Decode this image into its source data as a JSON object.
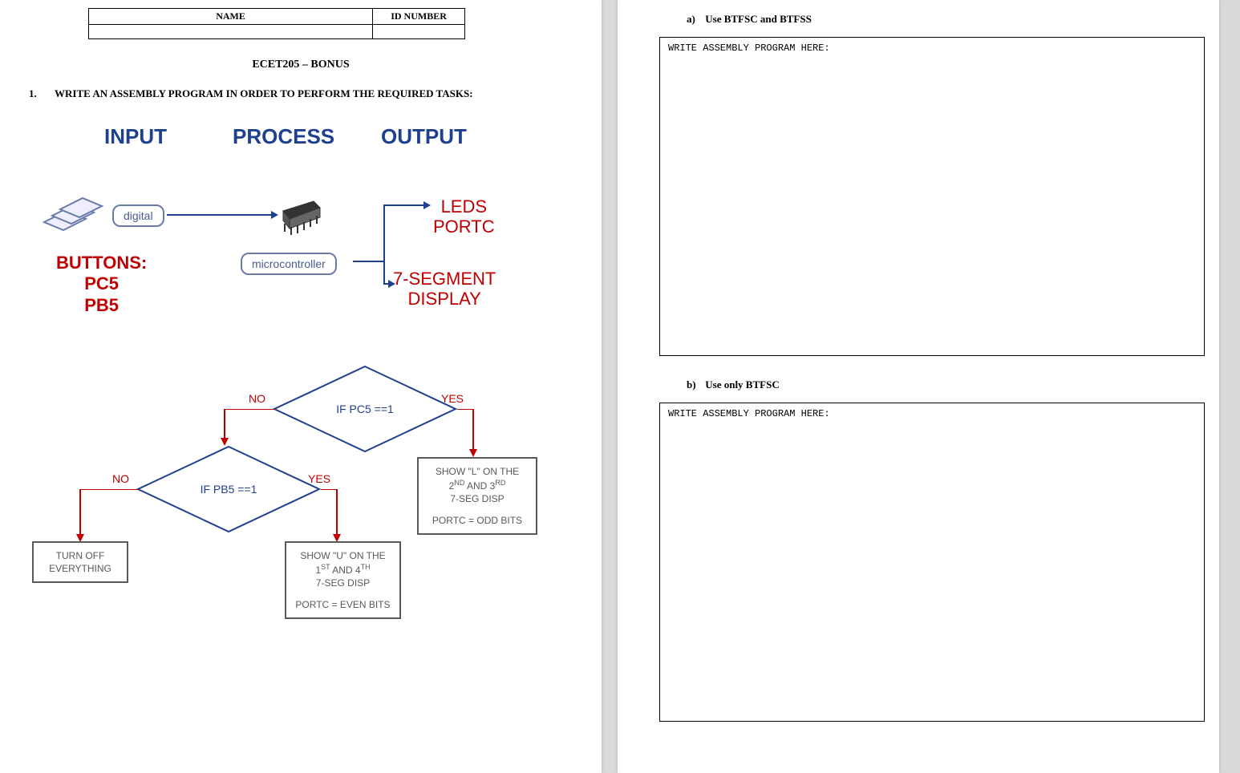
{
  "header": {
    "name_col": "NAME",
    "id_col": "ID NUMBER",
    "name_val": "",
    "id_val": ""
  },
  "course_title": "ECET205 – BONUS",
  "q1": {
    "num": "1.",
    "text": "WRITE AN ASSEMBLY PROGRAM IN ORDER TO PERFORM THE REQUIRED TASKS:"
  },
  "ipo": {
    "hdr_input": "INPUT",
    "hdr_process": "PROCESS",
    "hdr_output": "OUTPUT",
    "digital": "digital",
    "microcontroller": "microcontroller",
    "buttons_title": "BUTTONS:",
    "buttons_l1": "PC5",
    "buttons_l2": "PB5",
    "out_leds_l1": "LEDS",
    "out_leds_l2": "PORTC",
    "out_seg_l1": "7-SEGMENT",
    "out_seg_l2": "DISPLAY"
  },
  "flow": {
    "d1": "IF PC5 ==1",
    "d2": "IF PB5 ==1",
    "yes": "YES",
    "no": "NO",
    "box_L_l1": "SHOW \"L\" ON THE",
    "box_L_l2a": "2",
    "box_L_l2sup1": "ND",
    "box_L_l2mid": " AND 3",
    "box_L_l2sup2": "RD",
    "box_L_l3": "7-SEG DISP",
    "box_L_l4": "PORTC = ODD BITS",
    "box_U_l1": "SHOW \"U\" ON THE",
    "box_U_l2a": "1",
    "box_U_l2sup1": "ST",
    "box_U_l2mid": " AND 4",
    "box_U_l2sup2": "TH",
    "box_U_l3": "7-SEG DISP",
    "box_U_l4": "PORTC = EVEN BITS",
    "box_off_l1": "TURN OFF",
    "box_off_l2": "EVERYTHING"
  },
  "right": {
    "a_lbl": "a)",
    "a_text": "Use BTFSC and BTFSS",
    "b_lbl": "b)",
    "b_text": "Use only BTFSC",
    "placeholder": "WRITE ASSEMBLY PROGRAM HERE:"
  }
}
